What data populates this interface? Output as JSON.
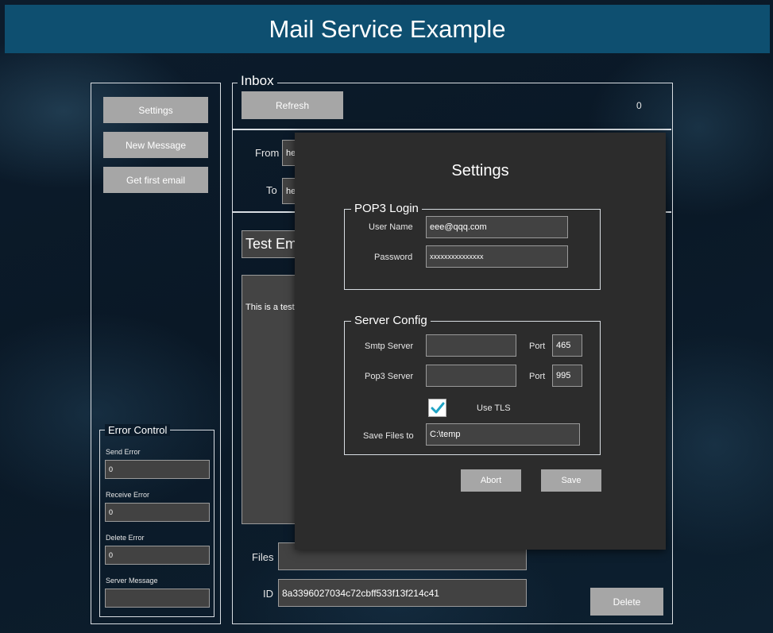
{
  "app": {
    "title": "Mail Service Example"
  },
  "sidebar": {
    "buttons": {
      "settings": "Settings",
      "new_message": "New Message",
      "get_first_email": "Get first email"
    },
    "error_control": {
      "title": "Error Control",
      "send_error_label": "Send Error",
      "send_error_value": "0",
      "receive_error_label": "Receive Error",
      "receive_error_value": "0",
      "delete_error_label": "Delete Error",
      "delete_error_value": "0",
      "server_message_label": "Server Message",
      "server_message_value": ""
    }
  },
  "inbox": {
    "title": "Inbox",
    "refresh_label": "Refresh",
    "count": "0",
    "from_label": "From",
    "from_value": "he",
    "to_label": "To",
    "to_value": "he",
    "subject_value": "Test Em",
    "body_value": "This is a test",
    "files_label": "Files",
    "files_value": "",
    "id_label": "ID",
    "id_value": "8a3396027034c72cbff533f13f214c41",
    "delete_label": "Delete"
  },
  "settings": {
    "title": "Settings",
    "pop3_login": {
      "title": "POP3 Login",
      "username_label": "User Name",
      "username_value": "eee@qqq.com",
      "password_label": "Password",
      "password_value": "xxxxxxxxxxxxxxx"
    },
    "server_config": {
      "title": "Server Config",
      "smtp_label": "Smtp Server",
      "smtp_value": "",
      "smtp_port_label": "Port",
      "smtp_port_value": "465",
      "pop3_label": "Pop3 Server",
      "pop3_value": "",
      "pop3_port_label": "Port",
      "pop3_port_value": "995",
      "use_tls_label": "Use TLS",
      "use_tls_checked": true,
      "save_files_label": "Save Files to",
      "save_files_value": "C:\\temp"
    },
    "abort_label": "Abort",
    "save_label": "Save"
  },
  "colors": {
    "header": "#0e4f70",
    "check_accent": "#1fa3c4",
    "button": "#a6a6a6",
    "modal": "#2c2c2c"
  }
}
